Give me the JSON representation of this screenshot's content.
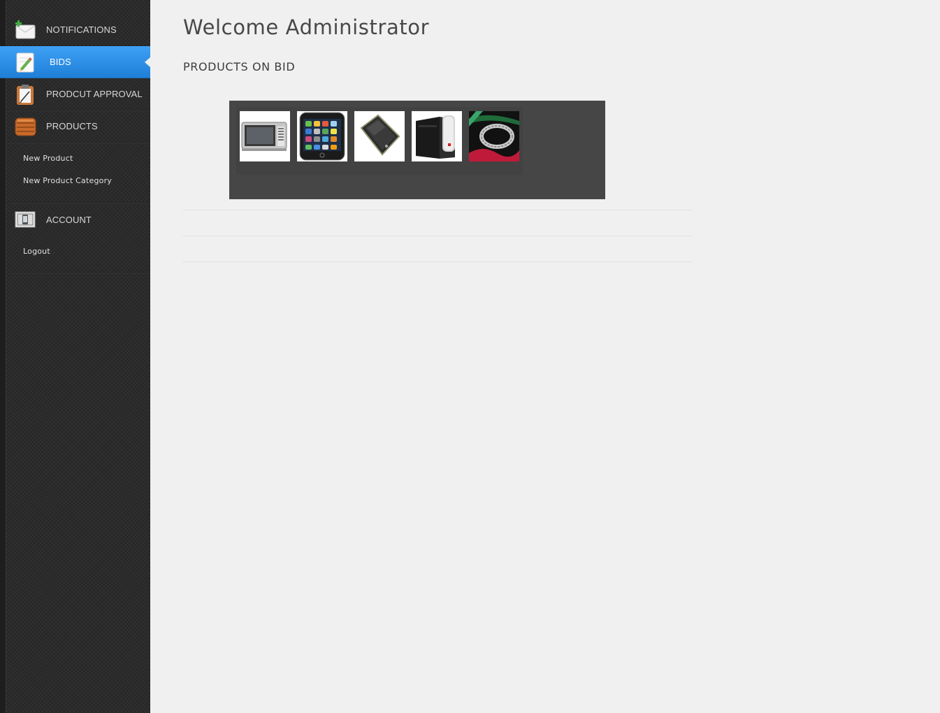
{
  "sidebar": {
    "items": [
      {
        "label": "NOTIFICATIONS",
        "icon": "envelope-icon"
      },
      {
        "label": "BIDS",
        "icon": "pencil-note-icon",
        "active": true
      },
      {
        "label": "PRODCUT APPROVAL",
        "icon": "clipboard-icon"
      },
      {
        "label": "PRODUCTS",
        "icon": "wooden-box-icon"
      }
    ],
    "product_links": [
      {
        "label": "New Product"
      },
      {
        "label": "New Product Category"
      }
    ],
    "account": {
      "label": "ACCOUNT",
      "icon": "phone-frame-icon"
    },
    "account_links": [
      {
        "label": "Logout"
      }
    ]
  },
  "main": {
    "welcome": "Welcome Administrator",
    "section_title": "PRODUCTS ON BID",
    "products": [
      {
        "name": "microwave-oven"
      },
      {
        "name": "iphone"
      },
      {
        "name": "black-smartphone"
      },
      {
        "name": "desktop-tower"
      },
      {
        "name": "silver-ring"
      }
    ]
  },
  "colors": {
    "active_blue": "#2a8ee8",
    "sidebar_bg": "#2b2b2b",
    "gallery_bg": "#464646",
    "page_bg": "#f0f0f0"
  }
}
